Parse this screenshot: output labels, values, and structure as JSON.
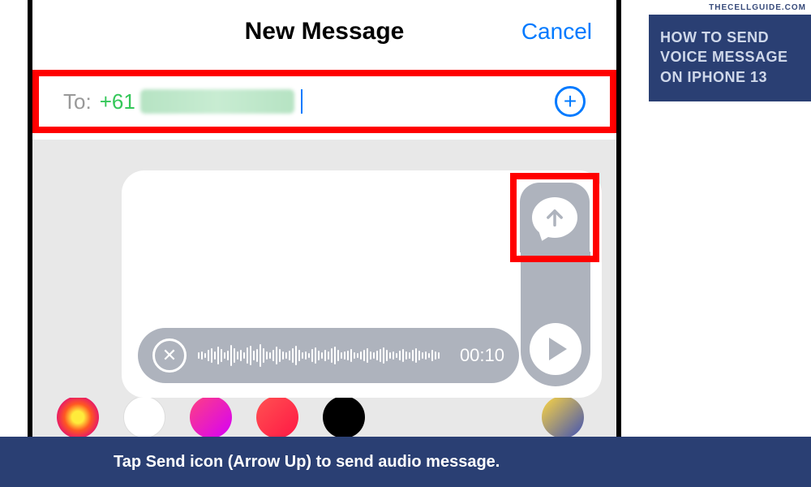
{
  "header": {
    "title": "New Message",
    "cancel": "Cancel"
  },
  "recipient": {
    "to_label": "To:",
    "prefix": "+61",
    "plus_glyph": "+"
  },
  "audio": {
    "duration": "00:10",
    "close_glyph": "✕"
  },
  "caption": "Tap Send icon (Arrow Up) to send audio message.",
  "sidebar": {
    "watermark": "THECELLGUIDE.COM",
    "banner": "HOW TO SEND VOICE  MESSAGE ON IPHONE 13"
  }
}
